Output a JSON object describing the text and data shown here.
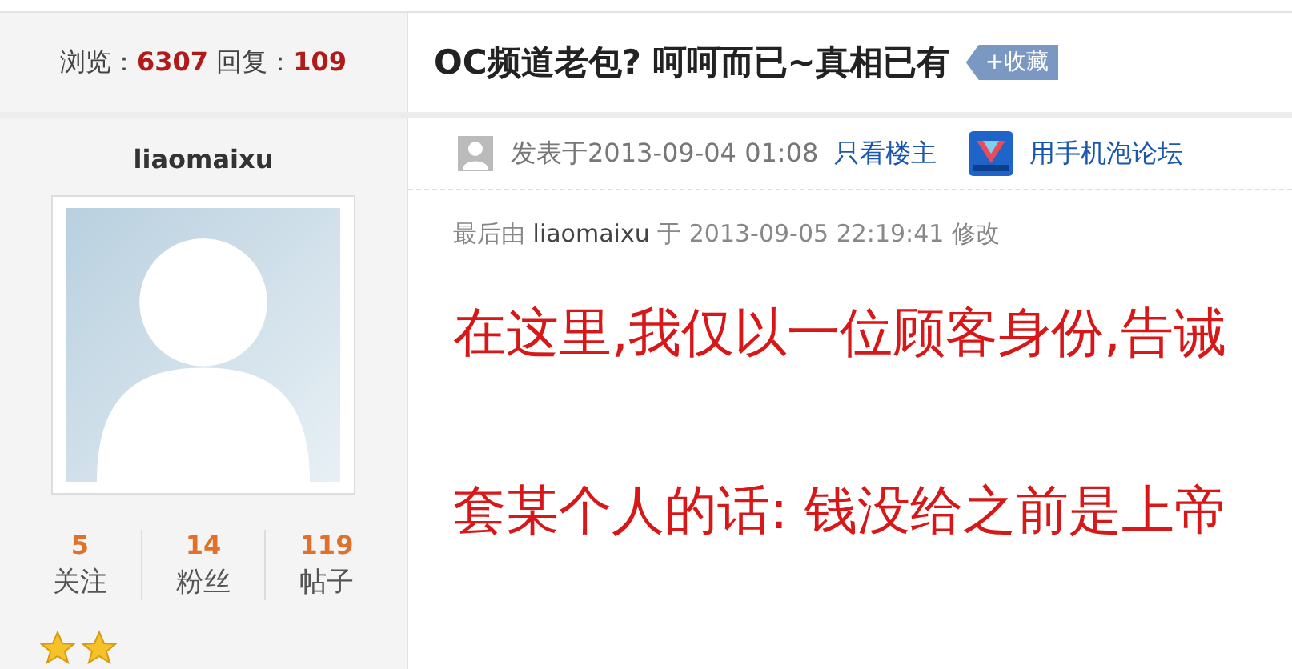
{
  "thread_stats": {
    "views_label": "浏览：",
    "views": "6307",
    "replies_label": "回复：",
    "replies": "109"
  },
  "thread_title": "OC频道老包? 呵呵而已~真相已有",
  "favorite_button": "+收藏",
  "author": {
    "username": "liaomaixu",
    "stats": [
      {
        "value": "5",
        "label": "关注"
      },
      {
        "value": "14",
        "label": "粉丝"
      },
      {
        "value": "119",
        "label": "帖子"
      }
    ]
  },
  "post_meta": {
    "posted": "发表于2013-09-04 01:08",
    "only_author_link": "只看楼主",
    "mobile_link": "用手机泡论坛"
  },
  "edit_note": {
    "prefix": "最后由",
    "user": "liaomaixu",
    "middle": "于 2013-09-05 22:19:41 修改"
  },
  "body_lines": [
    "在这里,我仅以一位顾客身份,告诫",
    "套某个人的话: 钱没给之前是上帝"
  ]
}
